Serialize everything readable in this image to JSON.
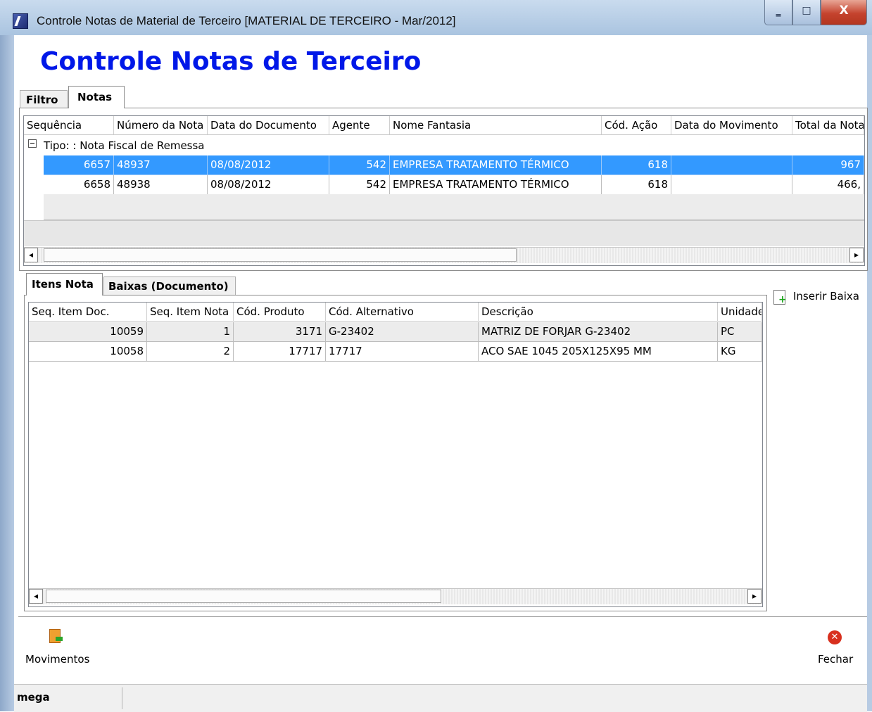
{
  "window": {
    "title": "Controle Notas de Material de Terceiro [MATERIAL DE TERCEIRO - Mar/2012]",
    "minimize_glyph": "‗",
    "maximize_glyph": "□",
    "close_glyph": "X"
  },
  "heading": "Controle Notas de Terceiro",
  "top_tabs": [
    "Filtro",
    "Notas"
  ],
  "notas_grid": {
    "columns": [
      "Sequência",
      "Número da Nota",
      "Data do Documento",
      "Agente",
      "Nome Fantasia",
      "Cód. Ação",
      "Data do Movimento",
      "Total da Nota"
    ],
    "group_label": "Tipo: : Nota Fiscal de Remessa",
    "rows": [
      {
        "sequencia": "6657",
        "numero": "48937",
        "data_doc": "08/08/2012",
        "agente": "542",
        "nome": "EMPRESA TRATAMENTO TÉRMICO",
        "acao": "618",
        "data_mov": "",
        "total": "967"
      },
      {
        "sequencia": "6658",
        "numero": "48938",
        "data_doc": "08/08/2012",
        "agente": "542",
        "nome": "EMPRESA TRATAMENTO TÉRMICO",
        "acao": "618",
        "data_mov": "",
        "total": "466,"
      }
    ],
    "selected_row": 0
  },
  "lower_tabs": [
    "Itens Nota",
    "Baixas (Documento)"
  ],
  "itens_grid": {
    "columns": [
      "Seq. Item Doc.",
      "Seq. Item Nota",
      "Cód. Produto",
      "Cód. Alternativo",
      "Descrição",
      "Unidade"
    ],
    "rows": [
      {
        "seq_doc": "10059",
        "seq_nota": "1",
        "produto": "3171",
        "alternativo": "G-23402",
        "descricao": "MATRIZ DE FORJAR G-23402",
        "unidade": "PC"
      },
      {
        "seq_doc": "10058",
        "seq_nota": "2",
        "produto": "17717",
        "alternativo": "17717",
        "descricao": "ACO SAE 1045 205X125X95 MM",
        "unidade": "KG"
      }
    ]
  },
  "actions": {
    "inserir_baixa": "Inserir Baixa",
    "movimentos": "Movimentos",
    "fechar": "Fechar"
  },
  "status": {
    "left": "mega"
  },
  "icons": {
    "app": "app-logo-icon",
    "inserir_baixa": "document-add-icon",
    "movimentos": "movements-icon",
    "fechar": "close-circle-icon",
    "group_toggle": "collapse-icon",
    "scroll_left": "arrow-left-icon",
    "scroll_right": "arrow-right-icon"
  },
  "colors": {
    "heading": "#0018e8",
    "selection": "#3399ff",
    "close_button": "#d8301e"
  }
}
